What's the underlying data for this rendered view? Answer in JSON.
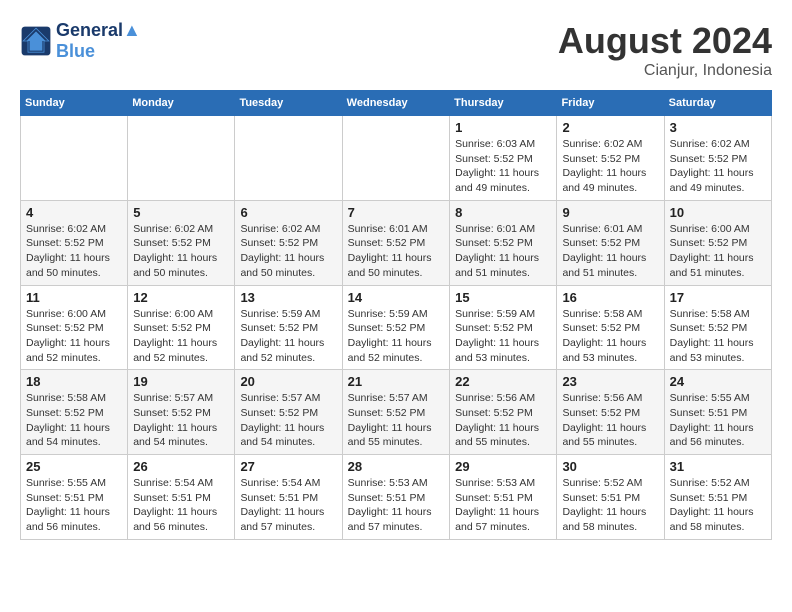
{
  "header": {
    "logo_line1": "General",
    "logo_line2": "Blue",
    "month_year": "August 2024",
    "location": "Cianjur, Indonesia"
  },
  "weekdays": [
    "Sunday",
    "Monday",
    "Tuesday",
    "Wednesday",
    "Thursday",
    "Friday",
    "Saturday"
  ],
  "weeks": [
    [
      {
        "day": "",
        "info": ""
      },
      {
        "day": "",
        "info": ""
      },
      {
        "day": "",
        "info": ""
      },
      {
        "day": "",
        "info": ""
      },
      {
        "day": "1",
        "info": "Sunrise: 6:03 AM\nSunset: 5:52 PM\nDaylight: 11 hours\nand 49 minutes."
      },
      {
        "day": "2",
        "info": "Sunrise: 6:02 AM\nSunset: 5:52 PM\nDaylight: 11 hours\nand 49 minutes."
      },
      {
        "day": "3",
        "info": "Sunrise: 6:02 AM\nSunset: 5:52 PM\nDaylight: 11 hours\nand 49 minutes."
      }
    ],
    [
      {
        "day": "4",
        "info": "Sunrise: 6:02 AM\nSunset: 5:52 PM\nDaylight: 11 hours\nand 50 minutes."
      },
      {
        "day": "5",
        "info": "Sunrise: 6:02 AM\nSunset: 5:52 PM\nDaylight: 11 hours\nand 50 minutes."
      },
      {
        "day": "6",
        "info": "Sunrise: 6:02 AM\nSunset: 5:52 PM\nDaylight: 11 hours\nand 50 minutes."
      },
      {
        "day": "7",
        "info": "Sunrise: 6:01 AM\nSunset: 5:52 PM\nDaylight: 11 hours\nand 50 minutes."
      },
      {
        "day": "8",
        "info": "Sunrise: 6:01 AM\nSunset: 5:52 PM\nDaylight: 11 hours\nand 51 minutes."
      },
      {
        "day": "9",
        "info": "Sunrise: 6:01 AM\nSunset: 5:52 PM\nDaylight: 11 hours\nand 51 minutes."
      },
      {
        "day": "10",
        "info": "Sunrise: 6:00 AM\nSunset: 5:52 PM\nDaylight: 11 hours\nand 51 minutes."
      }
    ],
    [
      {
        "day": "11",
        "info": "Sunrise: 6:00 AM\nSunset: 5:52 PM\nDaylight: 11 hours\nand 52 minutes."
      },
      {
        "day": "12",
        "info": "Sunrise: 6:00 AM\nSunset: 5:52 PM\nDaylight: 11 hours\nand 52 minutes."
      },
      {
        "day": "13",
        "info": "Sunrise: 5:59 AM\nSunset: 5:52 PM\nDaylight: 11 hours\nand 52 minutes."
      },
      {
        "day": "14",
        "info": "Sunrise: 5:59 AM\nSunset: 5:52 PM\nDaylight: 11 hours\nand 52 minutes."
      },
      {
        "day": "15",
        "info": "Sunrise: 5:59 AM\nSunset: 5:52 PM\nDaylight: 11 hours\nand 53 minutes."
      },
      {
        "day": "16",
        "info": "Sunrise: 5:58 AM\nSunset: 5:52 PM\nDaylight: 11 hours\nand 53 minutes."
      },
      {
        "day": "17",
        "info": "Sunrise: 5:58 AM\nSunset: 5:52 PM\nDaylight: 11 hours\nand 53 minutes."
      }
    ],
    [
      {
        "day": "18",
        "info": "Sunrise: 5:58 AM\nSunset: 5:52 PM\nDaylight: 11 hours\nand 54 minutes."
      },
      {
        "day": "19",
        "info": "Sunrise: 5:57 AM\nSunset: 5:52 PM\nDaylight: 11 hours\nand 54 minutes."
      },
      {
        "day": "20",
        "info": "Sunrise: 5:57 AM\nSunset: 5:52 PM\nDaylight: 11 hours\nand 54 minutes."
      },
      {
        "day": "21",
        "info": "Sunrise: 5:57 AM\nSunset: 5:52 PM\nDaylight: 11 hours\nand 55 minutes."
      },
      {
        "day": "22",
        "info": "Sunrise: 5:56 AM\nSunset: 5:52 PM\nDaylight: 11 hours\nand 55 minutes."
      },
      {
        "day": "23",
        "info": "Sunrise: 5:56 AM\nSunset: 5:52 PM\nDaylight: 11 hours\nand 55 minutes."
      },
      {
        "day": "24",
        "info": "Sunrise: 5:55 AM\nSunset: 5:51 PM\nDaylight: 11 hours\nand 56 minutes."
      }
    ],
    [
      {
        "day": "25",
        "info": "Sunrise: 5:55 AM\nSunset: 5:51 PM\nDaylight: 11 hours\nand 56 minutes."
      },
      {
        "day": "26",
        "info": "Sunrise: 5:54 AM\nSunset: 5:51 PM\nDaylight: 11 hours\nand 56 minutes."
      },
      {
        "day": "27",
        "info": "Sunrise: 5:54 AM\nSunset: 5:51 PM\nDaylight: 11 hours\nand 57 minutes."
      },
      {
        "day": "28",
        "info": "Sunrise: 5:53 AM\nSunset: 5:51 PM\nDaylight: 11 hours\nand 57 minutes."
      },
      {
        "day": "29",
        "info": "Sunrise: 5:53 AM\nSunset: 5:51 PM\nDaylight: 11 hours\nand 57 minutes."
      },
      {
        "day": "30",
        "info": "Sunrise: 5:52 AM\nSunset: 5:51 PM\nDaylight: 11 hours\nand 58 minutes."
      },
      {
        "day": "31",
        "info": "Sunrise: 5:52 AM\nSunset: 5:51 PM\nDaylight: 11 hours\nand 58 minutes."
      }
    ]
  ]
}
